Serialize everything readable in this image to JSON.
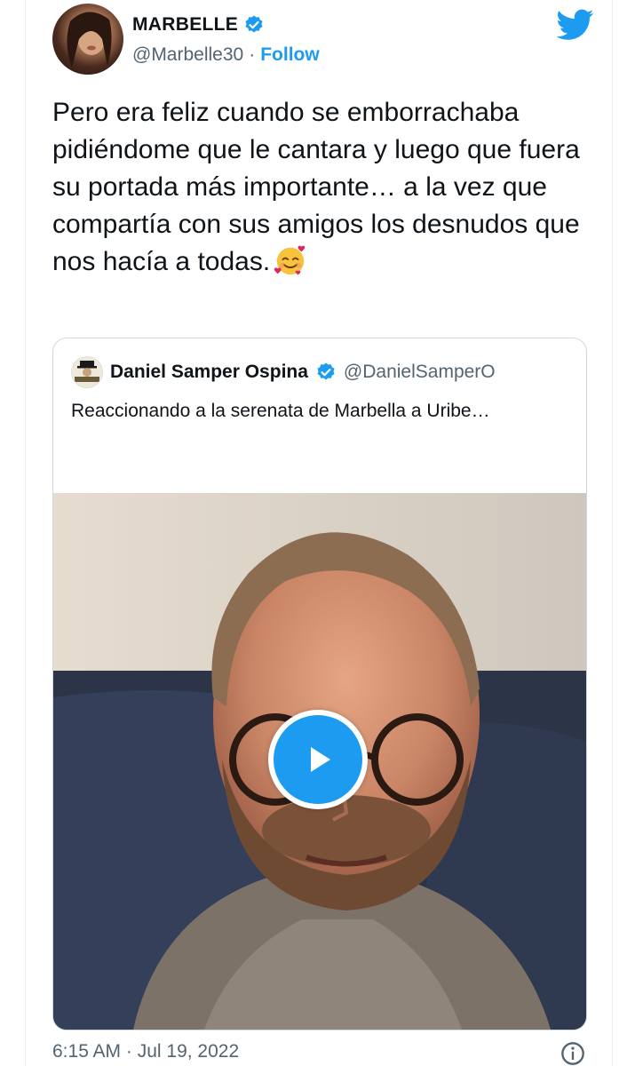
{
  "author": {
    "name": "MARBELLE",
    "handle": "@Marbelle30",
    "separator": "·",
    "follow_label": "Follow"
  },
  "tweet": {
    "text": "Pero era feliz cuando se emborrachaba pidiéndome que le cantara y luego que fuera su portada más importante… a la vez que compartía con sus amigos los desnudos que nos hacía a todas.",
    "emoji": "smiling-face-with-hearts"
  },
  "quoted": {
    "name": "Daniel Samper Ospina",
    "handle": "@DanielSamperO",
    "text": "Reaccionando a la serenata de Marbella a Uribe…"
  },
  "meta": {
    "timestamp": "6:15 AM · Jul 19, 2022"
  },
  "icons": {
    "verified": "verified-badge-icon",
    "logo": "twitter-bird-icon",
    "play": "play-icon",
    "info": "info-icon"
  },
  "colors": {
    "accent": "#1d9bf0",
    "text": "#0f1419",
    "secondary": "#536471"
  }
}
